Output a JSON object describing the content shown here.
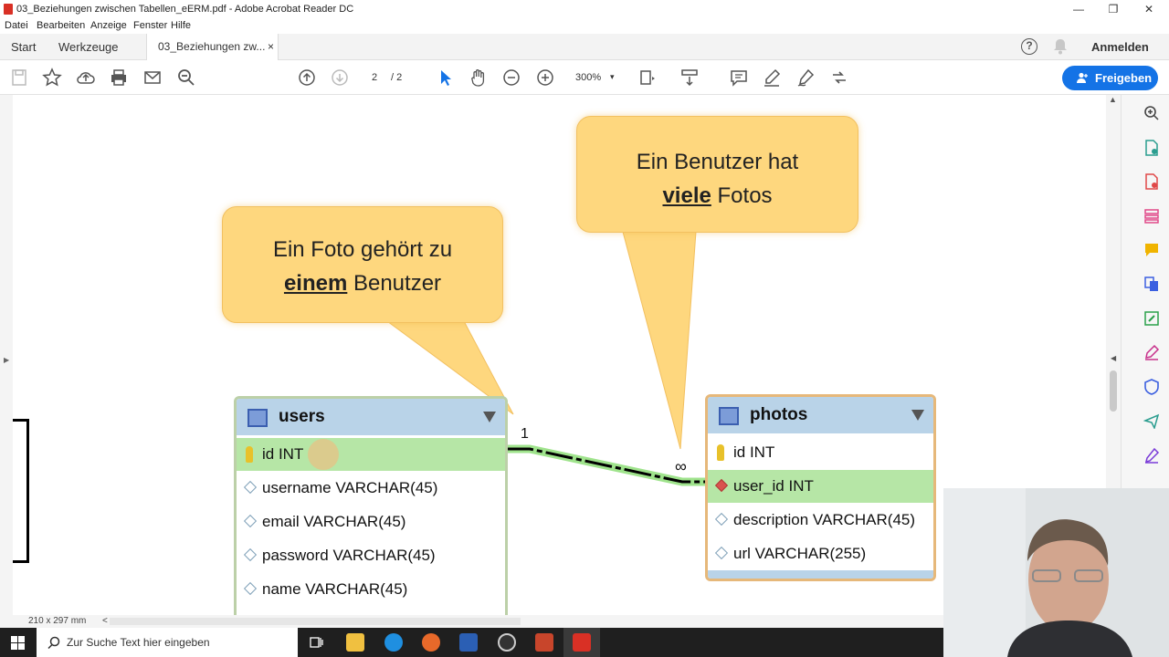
{
  "window": {
    "title": "03_Beziehungen zwischen Tabellen_eERM.pdf - Adobe Acrobat Reader DC",
    "minimize": "—",
    "maximize": "❐",
    "close": "✕"
  },
  "menu": [
    "Datei",
    "Bearbeiten",
    "Anzeige",
    "Fenster",
    "Hilfe"
  ],
  "tabs": {
    "start": "Start",
    "tools": "Werkzeuge",
    "document": "03_Beziehungen zw...",
    "close": "×",
    "help": "?",
    "signin": "Anmelden"
  },
  "toolbar": {
    "page_current": "2",
    "page_total": "/ 2",
    "zoom": "300%",
    "share": "Freigeben"
  },
  "diagram": {
    "bubble_left": {
      "line1": "Ein Foto gehört zu",
      "emph": "einem",
      "rest": " Benutzer"
    },
    "bubble_right": {
      "line1": "Ein Benutzer hat",
      "emph": "viele",
      "rest": " Fotos"
    },
    "cardinality_one": "1",
    "cardinality_many": "∞",
    "users": {
      "name": "users",
      "columns": [
        "id INT",
        "username VARCHAR(45)",
        "email VARCHAR(45)",
        "password VARCHAR(45)",
        "name VARCHAR(45)"
      ]
    },
    "photos": {
      "name": "photos",
      "columns": [
        "id INT",
        "user_id INT",
        "description VARCHAR(45)",
        "url VARCHAR(255)"
      ]
    }
  },
  "status": {
    "page_size": "210 x 297 mm",
    "scroll_left": "<"
  },
  "taskbar": {
    "search_placeholder": "Zur Suche Text hier eingeben"
  },
  "colors": {
    "accent": "#1473e6",
    "bubble": "#fed77e",
    "highlight_row": "#b6e6a6",
    "table_header": "#b9d3e8"
  }
}
